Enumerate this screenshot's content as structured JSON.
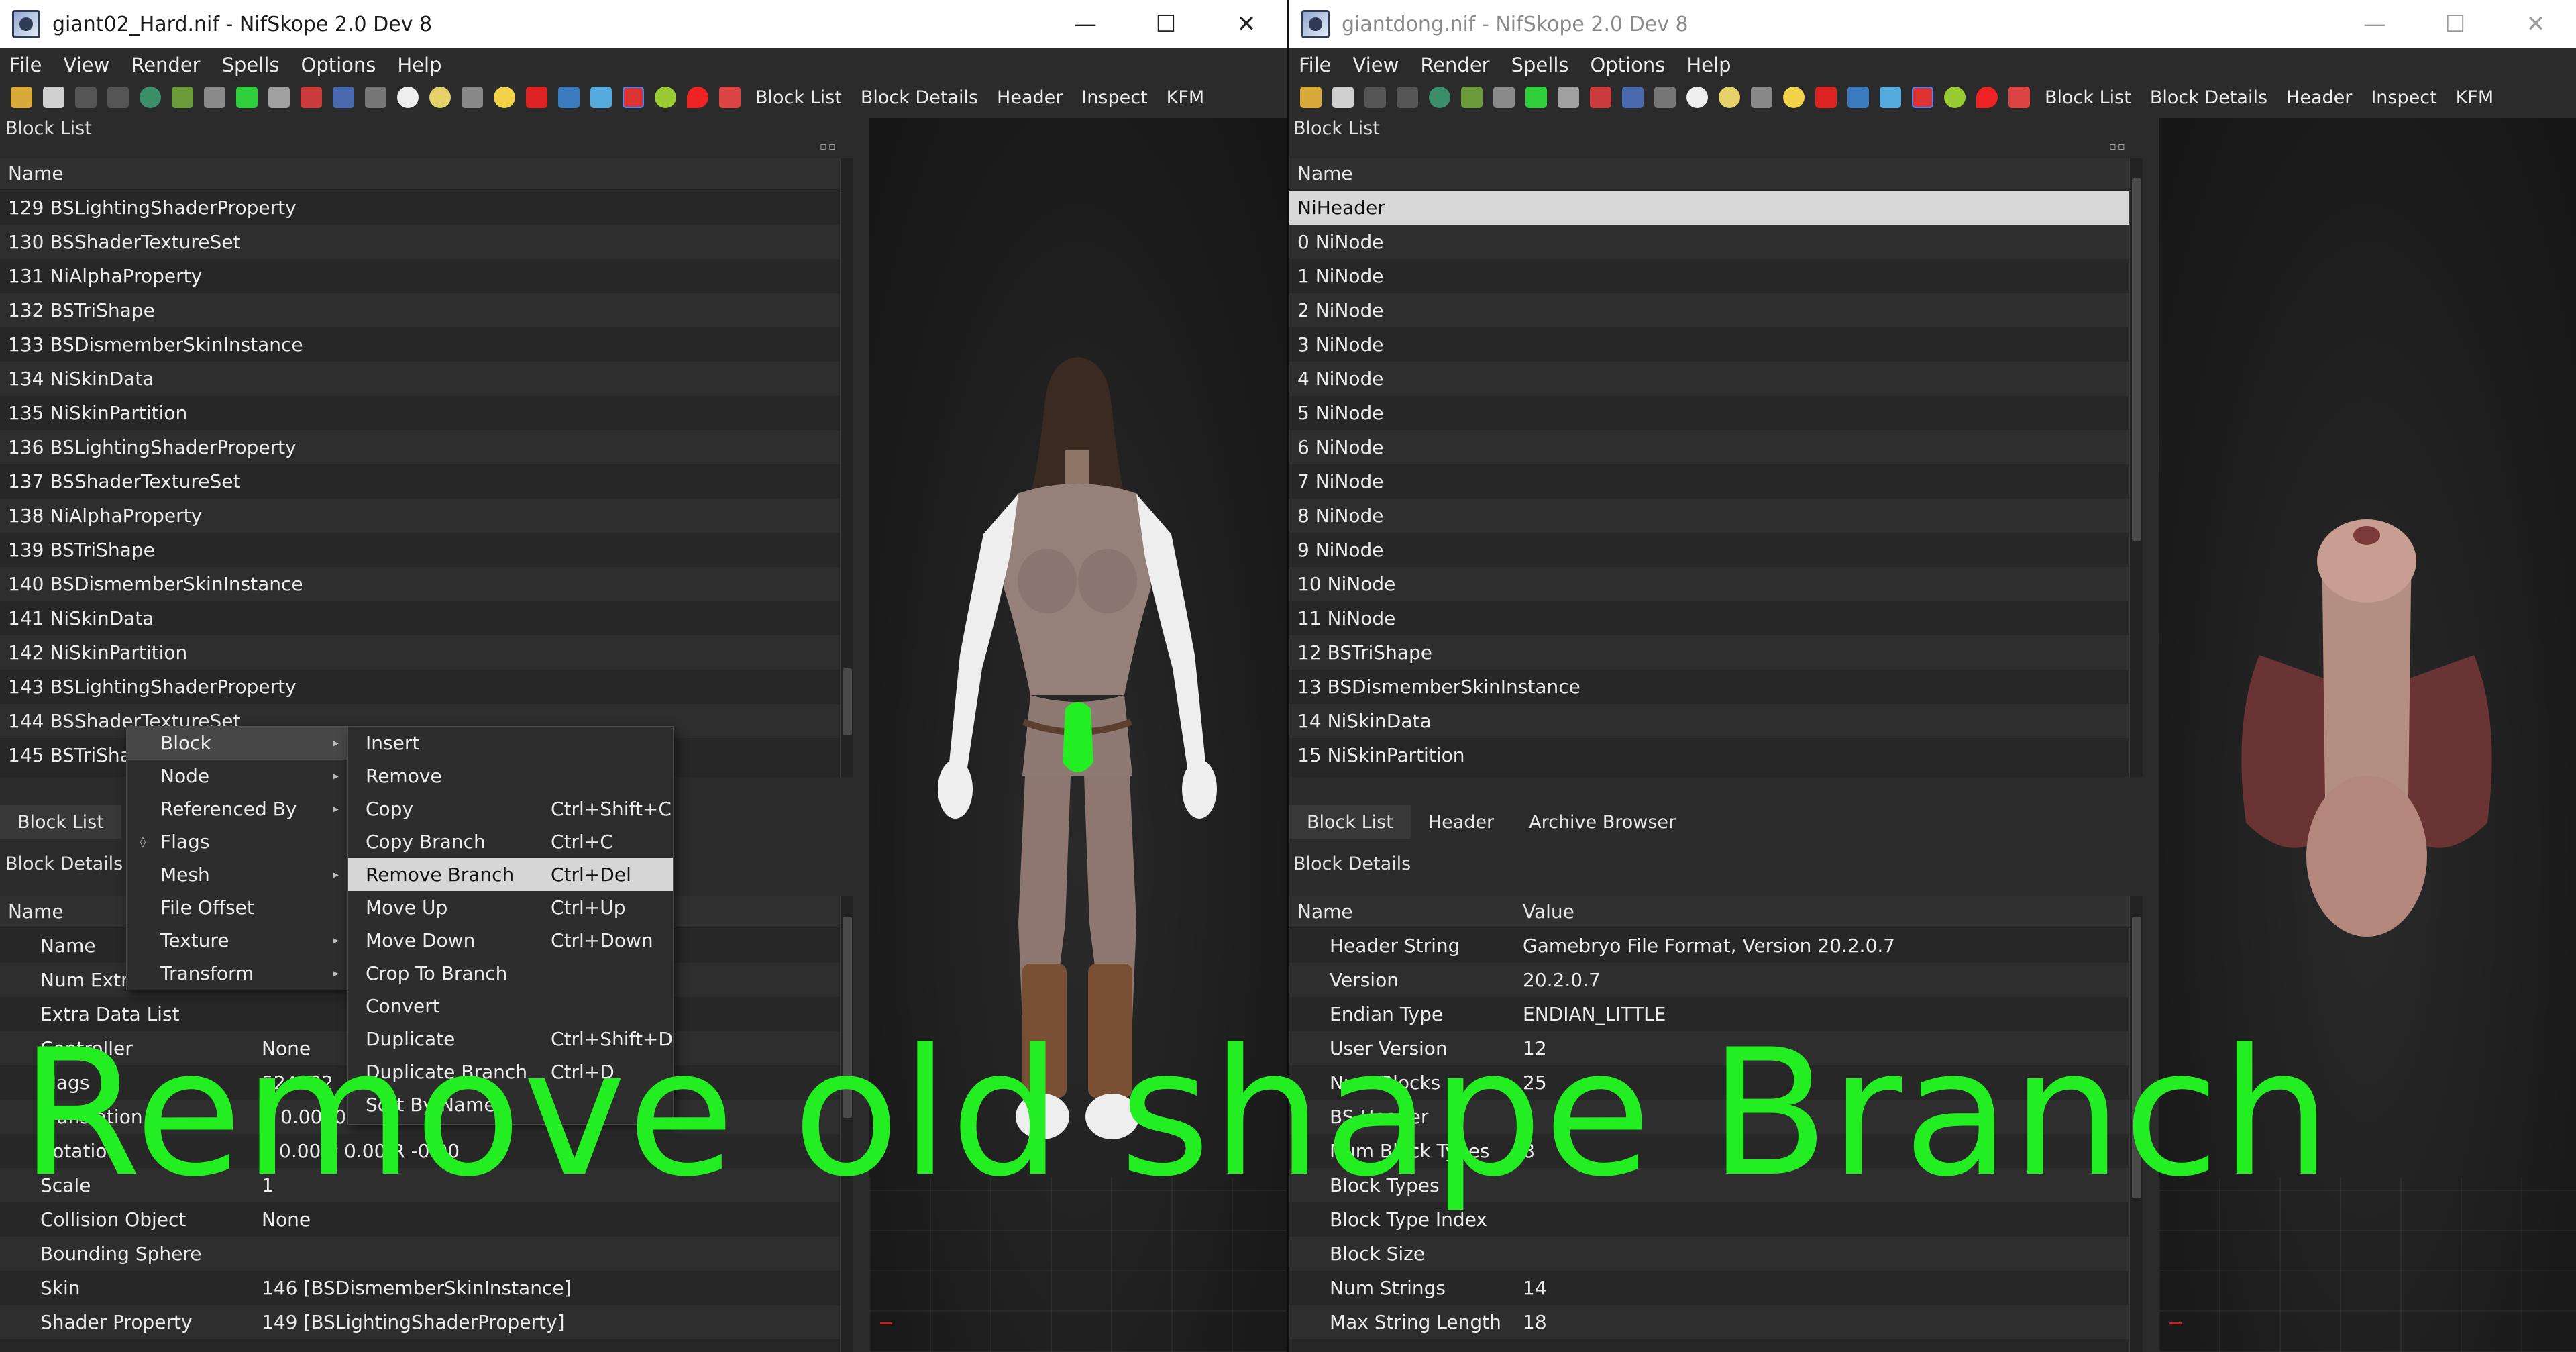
{
  "left": {
    "title": "giant02_Hard.nif - NifSkope 2.0 Dev 8",
    "menu": [
      "File",
      "View",
      "Render",
      "Spells",
      "Options",
      "Help"
    ],
    "toolbar_text": [
      "Block List",
      "Block Details",
      "Header",
      "Inspect",
      "KFM"
    ],
    "block_list": {
      "title": "Block List",
      "column": "Name",
      "rows": [
        "129 BSLightingShaderProperty",
        "130 BSShaderTextureSet",
        "131 NiAlphaProperty",
        "132 BSTriShape",
        "133 BSDismemberSkinInstance",
        "134 NiSkinData",
        "135 NiSkinPartition",
        "136 BSLightingShaderProperty",
        "137 BSShaderTextureSet",
        "138 NiAlphaProperty",
        "139 BSTriShape",
        "140 BSDismemberSkinInstance",
        "141 NiSkinData",
        "142 NiSkinPartition",
        "143 BSLightingShaderProperty",
        "144 BSShaderTextureSet",
        "145 BSTriShape"
      ]
    },
    "tab_label": "Block List",
    "details": {
      "title": "Block Details",
      "col_name": "Name",
      "rows": [
        {
          "name": "Name",
          "value": ""
        },
        {
          "name": "Num Extra Data List",
          "value": ""
        },
        {
          "name": "Extra Data List",
          "value": ""
        },
        {
          "name": "Controller",
          "value": "None"
        },
        {
          "name": "Flags",
          "value": "524302"
        },
        {
          "name": "Translation",
          "value": "X 0.0000  Y 0.0000  Z 0.0000"
        },
        {
          "name": "Rotation",
          "value": "Y 0.00  P 0.00  R -0.00"
        },
        {
          "name": "Scale",
          "value": "1"
        },
        {
          "name": "Collision Object",
          "value": "None"
        },
        {
          "name": "Bounding Sphere",
          "value": ""
        },
        {
          "name": "Skin",
          "value": "146 [BSDismemberSkinInstance]"
        },
        {
          "name": "Shader Property",
          "value": "149 [BSLightingShaderProperty]"
        }
      ]
    },
    "context_menu": [
      "Block",
      "Node",
      "Referenced By",
      "Flags",
      "Mesh",
      "File Offset",
      "Texture",
      "Transform"
    ],
    "submenu": [
      {
        "label": "Insert",
        "shortcut": ""
      },
      {
        "label": "Remove",
        "shortcut": ""
      },
      {
        "label": "Copy",
        "shortcut": "Ctrl+Shift+C"
      },
      {
        "label": "Copy Branch",
        "shortcut": "Ctrl+C"
      },
      {
        "label": "Remove Branch",
        "shortcut": "Ctrl+Del"
      },
      {
        "label": "Move Up",
        "shortcut": "Ctrl+Up"
      },
      {
        "label": "Move Down",
        "shortcut": "Ctrl+Down"
      },
      {
        "label": "Crop To Branch",
        "shortcut": ""
      },
      {
        "label": "Convert",
        "shortcut": ""
      },
      {
        "label": "Duplicate",
        "shortcut": "Ctrl+Shift+D"
      },
      {
        "label": "Duplicate Branch",
        "shortcut": "Ctrl+D"
      },
      {
        "label": "Sort By Name",
        "shortcut": ""
      }
    ]
  },
  "right": {
    "title": "giantdong.nif - NifSkope 2.0 Dev 8",
    "menu": [
      "File",
      "View",
      "Render",
      "Spells",
      "Options",
      "Help"
    ],
    "toolbar_text": [
      "Block List",
      "Block Details",
      "Header",
      "Inspect",
      "KFM"
    ],
    "block_list": {
      "title": "Block List",
      "column": "Name",
      "rows": [
        "NiHeader",
        "0 NiNode",
        "1 NiNode",
        "2 NiNode",
        "3 NiNode",
        "4 NiNode",
        "5 NiNode",
        "6 NiNode",
        "7 NiNode",
        "8 NiNode",
        "9 NiNode",
        "10 NiNode",
        "11 NiNode",
        "12 BSTriShape",
        "13 BSDismemberSkinInstance",
        "14 NiSkinData",
        "15 NiSkinPartition"
      ]
    },
    "tabs": [
      "Block List",
      "Header",
      "Archive Browser"
    ],
    "details": {
      "title": "Block Details",
      "col_name": "Name",
      "col_value": "Value",
      "rows": [
        {
          "name": "Header String",
          "value": "Gamebryo File Format, Version 20.2.0.7"
        },
        {
          "name": "Version",
          "value": "20.2.0.7"
        },
        {
          "name": "Endian Type",
          "value": "ENDIAN_LITTLE"
        },
        {
          "name": "User Version",
          "value": "12"
        },
        {
          "name": "Num Blocks",
          "value": "25"
        },
        {
          "name": "BS Header",
          "value": ""
        },
        {
          "name": "Num Block Types",
          "value": "8"
        },
        {
          "name": "Block Types",
          "value": ""
        },
        {
          "name": "Block Type Index",
          "value": ""
        },
        {
          "name": "Block Size",
          "value": ""
        },
        {
          "name": "Num Strings",
          "value": "14"
        },
        {
          "name": "Max String Length",
          "value": "18"
        }
      ]
    }
  },
  "overlay_text": "Remove old shape Branch",
  "colors": {
    "overlay": "#22ee22",
    "selection": "#d8d8d8",
    "panel": "#2b2b2b"
  }
}
